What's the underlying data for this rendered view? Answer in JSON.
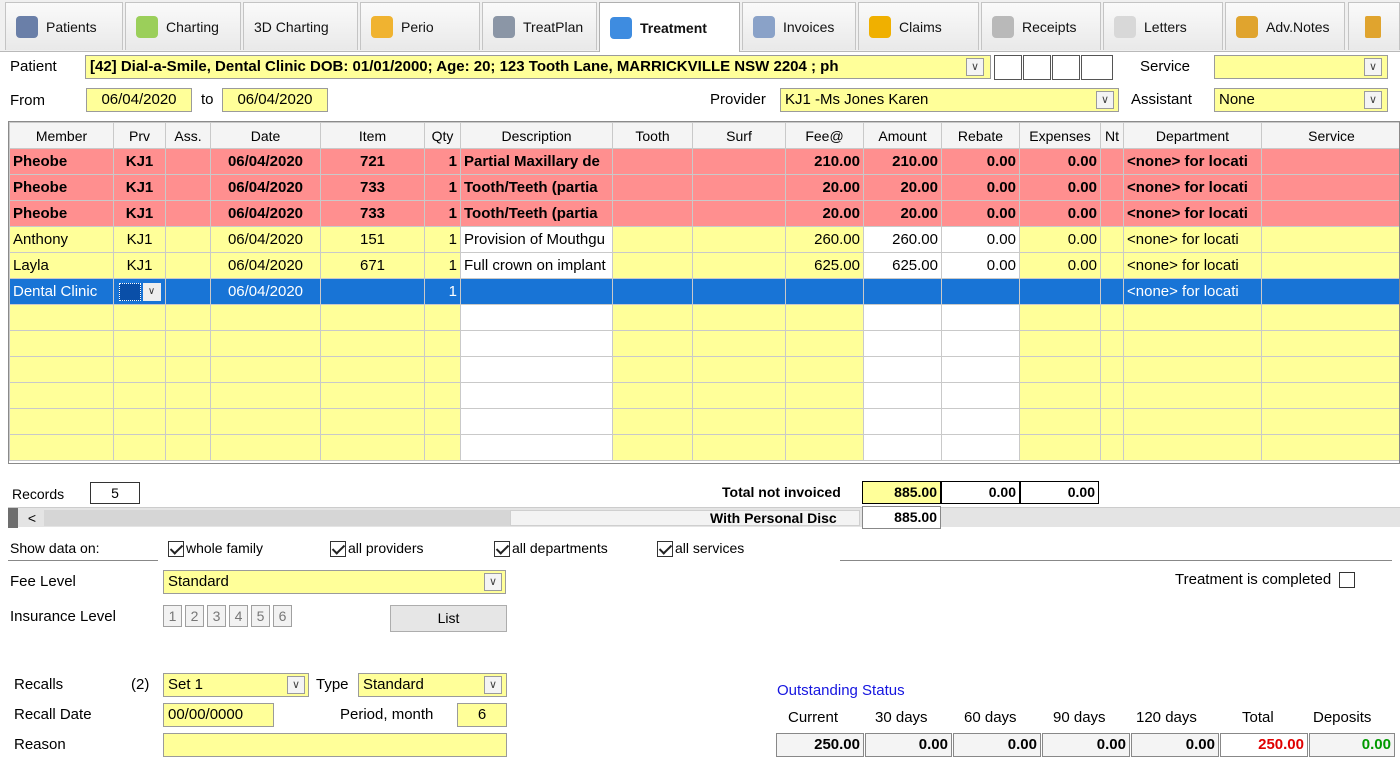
{
  "tabs": [
    {
      "label": "Patients",
      "icon": "patient-icon",
      "color": "#6a7fa8"
    },
    {
      "label": "Charting",
      "icon": "tooth-chart-icon",
      "color": "#9bcf5a"
    },
    {
      "label": "3D Charting",
      "icon": "",
      "color": ""
    },
    {
      "label": "Perio",
      "icon": "perio-icon",
      "color": "#f0b330"
    },
    {
      "label": "TreatPlan",
      "icon": "treatplan-icon",
      "color": "#8b96a6"
    },
    {
      "label": "Treatment",
      "icon": "treatment-tooth-icon",
      "color": "#3e8ce0"
    },
    {
      "label": "Invoices",
      "icon": "invoice-icon",
      "color": "#8aa2c8"
    },
    {
      "label": "Claims",
      "icon": "dollar-icon",
      "color": "#f0b000"
    },
    {
      "label": "Receipts",
      "icon": "receipt-icon",
      "color": "#b9b9b9"
    },
    {
      "label": "Letters",
      "icon": "envelope-icon",
      "color": "#d8d8d8"
    },
    {
      "label": "Adv.Notes",
      "icon": "notes-icon",
      "color": "#e0a42e"
    }
  ],
  "active_tab": "Treatment",
  "header": {
    "patient_label": "Patient",
    "patient_value": "[42] Dial-a-Smile, Dental Clinic DOB: 01/01/2000; Age: 20; 123 Tooth Lane, MARRICKVILLE NSW 2204 ; ph",
    "service_label": "Service",
    "service_value": "",
    "from_label": "From",
    "from_value": "06/04/2020",
    "to_label": "to",
    "to_value": "06/04/2020",
    "provider_label": "Provider",
    "provider_value": "KJ1 -Ms Jones Karen",
    "assistant_label": "Assistant",
    "assistant_value": "None"
  },
  "grid": {
    "columns": [
      "Member",
      "Prv",
      "Ass.",
      "Date",
      "Item",
      "Qty",
      "Description",
      "Tooth",
      "Surf",
      "Fee@",
      "Amount",
      "Rebate",
      "Expenses",
      "Nt",
      "Department",
      "Service"
    ],
    "rows": [
      {
        "style": "red",
        "member": "Pheobe",
        "prv": "KJ1",
        "ass": "",
        "date": "06/04/2020",
        "item": "721",
        "qty": "1",
        "desc": "Partial Maxillary de",
        "tooth": "",
        "surf": "",
        "fee": "210.00",
        "amount": "210.00",
        "rebate": "0.00",
        "expenses": "0.00",
        "nt": "",
        "dept": "<none> for locati",
        "service": ""
      },
      {
        "style": "red",
        "member": "Pheobe",
        "prv": "KJ1",
        "ass": "",
        "date": "06/04/2020",
        "item": "733",
        "qty": "1",
        "desc": "Tooth/Teeth (partia",
        "tooth": "",
        "surf": "",
        "fee": "20.00",
        "amount": "20.00",
        "rebate": "0.00",
        "expenses": "0.00",
        "nt": "",
        "dept": "<none> for locati",
        "service": ""
      },
      {
        "style": "red",
        "member": "Pheobe",
        "prv": "KJ1",
        "ass": "",
        "date": "06/04/2020",
        "item": "733",
        "qty": "1",
        "desc": "Tooth/Teeth (partia",
        "tooth": "",
        "surf": "",
        "fee": "20.00",
        "amount": "20.00",
        "rebate": "0.00",
        "expenses": "0.00",
        "nt": "",
        "dept": "<none> for locati",
        "service": ""
      },
      {
        "style": "normal",
        "member": "Anthony",
        "prv": "KJ1",
        "ass": "",
        "date": "06/04/2020",
        "item": "151",
        "qty": "1",
        "desc": "Provision of Mouthgu",
        "tooth": "",
        "surf": "",
        "fee": "260.00",
        "amount": "260.00",
        "rebate": "0.00",
        "expenses": "0.00",
        "nt": "",
        "dept": "<none> for locati",
        "service": ""
      },
      {
        "style": "normal",
        "member": "Layla",
        "prv": "KJ1",
        "ass": "",
        "date": "06/04/2020",
        "item": "671",
        "qty": "1",
        "desc": "Full crown on implant",
        "tooth": "",
        "surf": "",
        "fee": "625.00",
        "amount": "625.00",
        "rebate": "0.00",
        "expenses": "0.00",
        "nt": "",
        "dept": "<none> for locati",
        "service": ""
      },
      {
        "style": "sel",
        "member": "Dental Clinic",
        "prv": "",
        "ass": "",
        "date": "06/04/2020",
        "item": "",
        "qty": "1",
        "desc": "",
        "tooth": "",
        "surf": "",
        "fee": "",
        "amount": "",
        "rebate": "",
        "expenses": "",
        "nt": "",
        "dept": "<none> for locati",
        "service": ""
      }
    ],
    "empty_rows": 6
  },
  "footer": {
    "records_label": "Records",
    "records_value": "5",
    "total_label": "Total not invoiced",
    "total_amount": "885.00",
    "total_rebate": "0.00",
    "total_expenses": "0.00",
    "personal_disc_label": "With Personal Disc",
    "personal_disc_value": "885.00"
  },
  "show_data": {
    "label": "Show data on:",
    "options": [
      {
        "label": "whole family",
        "checked": true
      },
      {
        "label": "all providers",
        "checked": true
      },
      {
        "label": "all departments",
        "checked": true
      },
      {
        "label": "all services",
        "checked": true
      }
    ]
  },
  "fee_level": {
    "label": "Fee Level",
    "value": "Standard"
  },
  "treatment_completed": {
    "label": "Treatment is completed",
    "checked": false
  },
  "insurance": {
    "label": "Insurance Level",
    "levels": [
      "1",
      "2",
      "3",
      "4",
      "5",
      "6"
    ],
    "list_button": "List"
  },
  "recalls": {
    "label": "Recalls",
    "count": "(2)",
    "set_value": "Set 1",
    "type_label": "Type",
    "type_value": "Standard",
    "date_label": "Recall Date",
    "date_value": "00/00/0000",
    "period_label": "Period, month",
    "period_value": "6",
    "reason_label": "Reason",
    "reason_value": ""
  },
  "outstanding": {
    "title": "Outstanding Status",
    "headers": [
      "Current",
      "30 days",
      "60 days",
      "90 days",
      "120 days",
      "Total",
      "Deposits"
    ],
    "values": [
      "250.00",
      "0.00",
      "0.00",
      "0.00",
      "0.00",
      "250.00",
      "0.00"
    ],
    "title_color": "#1515e0",
    "total_color": "#e00000",
    "deposits_color": "#009a00"
  },
  "scrollbar": {
    "left_arrow": "<"
  }
}
